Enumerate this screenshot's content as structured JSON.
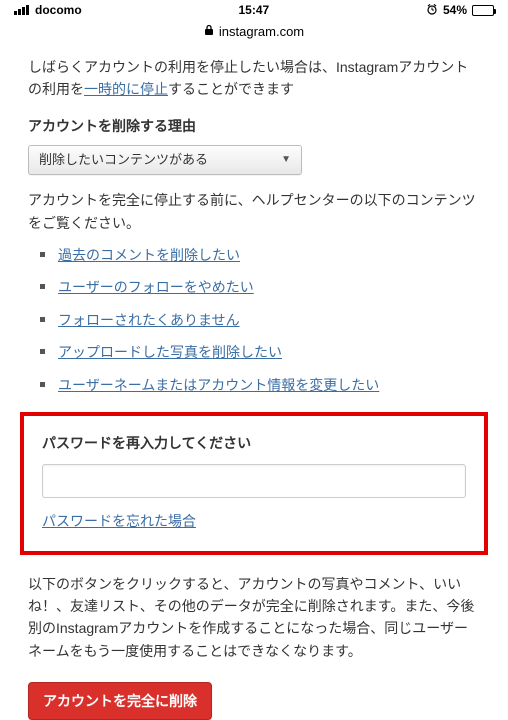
{
  "status": {
    "carrier": "docomo",
    "time": "15:47",
    "battery_pct": "54%"
  },
  "url": "instagram.com",
  "intro": {
    "before_link": "しばらくアカウントの利用を停止したい場合は、Instagramアカウントの利用を",
    "link_text": "一時的に停止",
    "after_link": "することができます"
  },
  "reason_heading": "アカウントを削除する理由",
  "reason_selected": "削除したいコンテンツがある",
  "help_prompt": "アカウントを完全に停止する前に、ヘルプセンターの以下のコンテンツをご覧ください。",
  "help_links": [
    "過去のコメントを削除したい",
    "ユーザーのフォローをやめたい",
    "フォローされたくありません",
    "アップロードした写真を削除したい",
    "ユーザーネームまたはアカウント情報を変更したい"
  ],
  "password_section": {
    "label": "パスワードを再入力してください",
    "forgot": "パスワードを忘れた場合"
  },
  "warning_text": "以下のボタンをクリックすると、アカウントの写真やコメント、いいね！、友達リスト、その他のデータが完全に削除されます。また、今後別のInstagramアカウントを作成することになった場合、同じユーザーネームをもう一度使用することはできなくなります。",
  "delete_button": "アカウントを完全に削除"
}
